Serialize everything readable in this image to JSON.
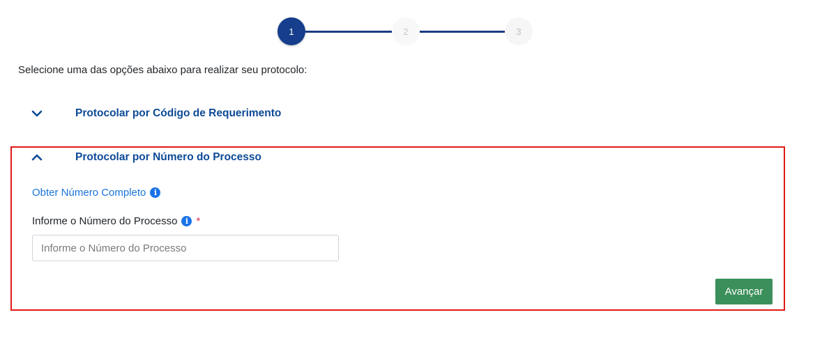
{
  "stepper": {
    "steps": [
      {
        "label": "1",
        "state": "active"
      },
      {
        "label": "2",
        "state": "inactive"
      },
      {
        "label": "3",
        "state": "inactive"
      }
    ]
  },
  "intro_text": "Selecione uma das opções abaixo para realizar seu protocolo:",
  "accordion": {
    "items": [
      {
        "title": "Protocolar por Código de Requerimento",
        "expanded": false,
        "icon": "chevron-down-icon"
      },
      {
        "title": "Protocolar por Número do Processo",
        "expanded": true,
        "icon": "chevron-up-icon"
      }
    ]
  },
  "panel": {
    "link_text": "Obter Número Completo",
    "field_label": "Informe o Número do Processo",
    "required_mark": "*",
    "input_placeholder": "Informe o Número do Processo",
    "input_value": "",
    "submit_label": "Avançar",
    "info_icon_glyph": "i"
  },
  "colors": {
    "primary": "#163e8c",
    "link": "#1a73d9",
    "heading": "#0d4a96",
    "button": "#3b8f5b",
    "highlight_border": "#e01818",
    "required": "#dc3545"
  }
}
